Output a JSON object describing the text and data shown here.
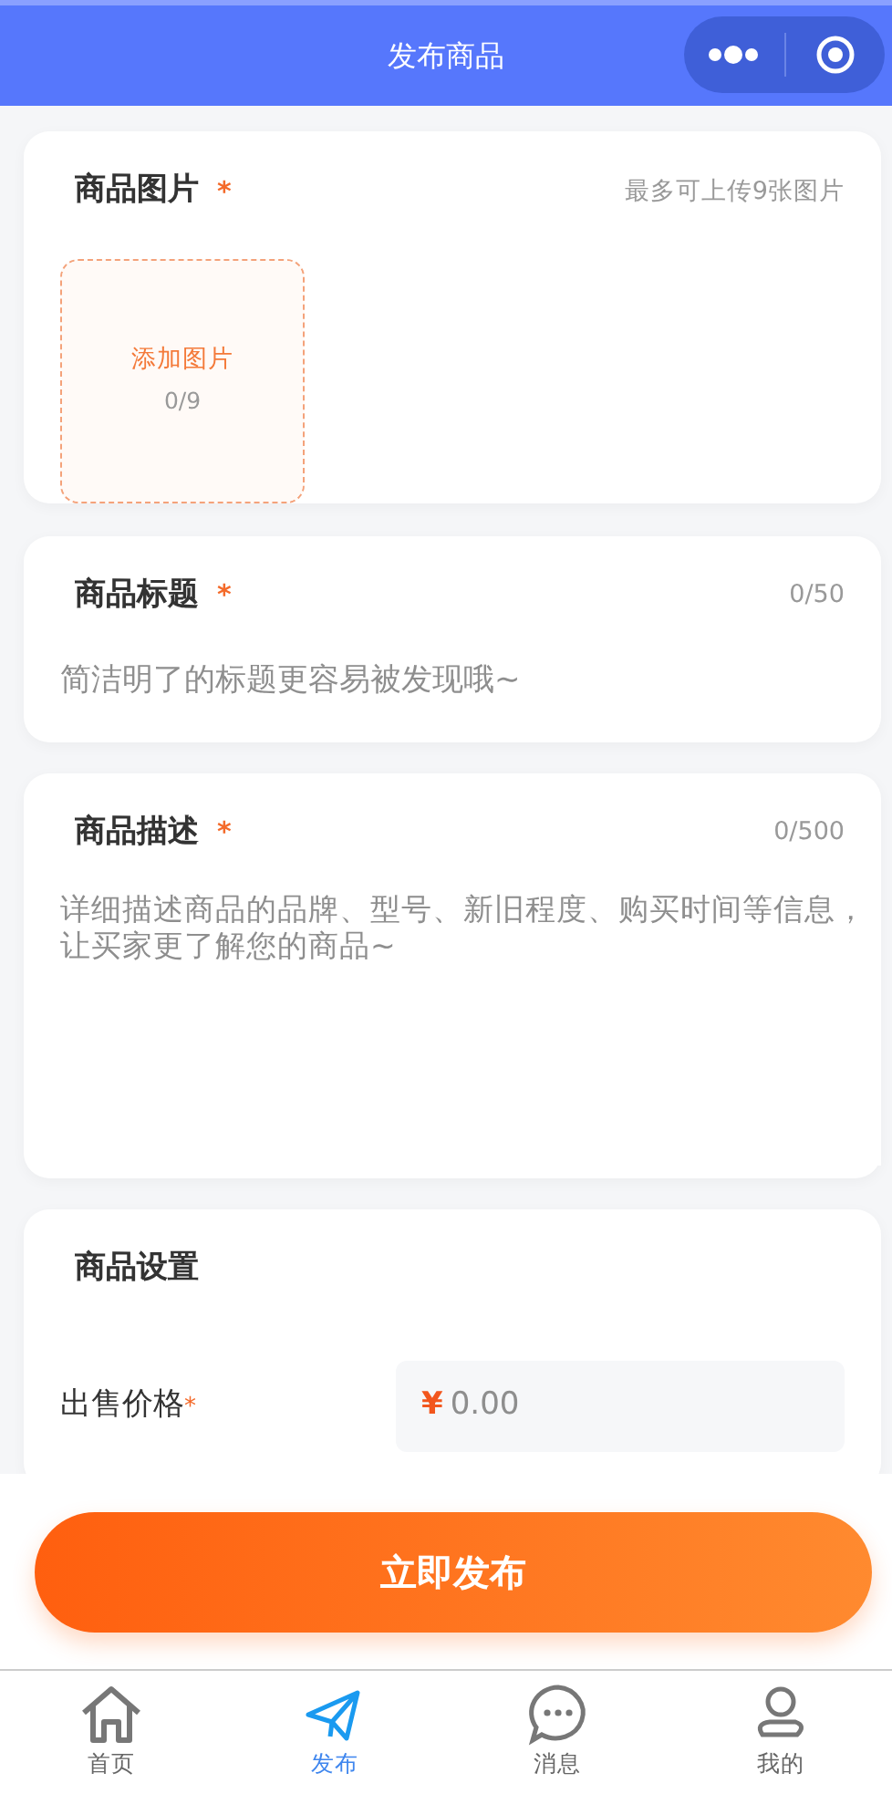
{
  "header": {
    "title": "发布商品"
  },
  "images": {
    "title": "商品图片",
    "required_mark": "*",
    "hint": "最多可上传9张图片",
    "add_label": "添加图片",
    "count": "0/9"
  },
  "title_field": {
    "title": "商品标题",
    "required_mark": "*",
    "counter": "0/50",
    "placeholder": "简洁明了的标题更容易被发现哦~"
  },
  "description_field": {
    "title": "商品描述",
    "required_mark": "*",
    "counter": "0/500",
    "placeholder": "详细描述商品的品牌、型号、新旧程度、购买时间等信息，让买家更了解您的商品~"
  },
  "settings": {
    "title": "商品设置",
    "price_label": "出售价格",
    "required_mark": "*",
    "currency": "¥",
    "price_placeholder": "0.00"
  },
  "submit_button": "立即发布",
  "tabs": [
    {
      "label": "首页",
      "kind": "home",
      "selected": false
    },
    {
      "label": "发布",
      "kind": "publish",
      "selected": true
    },
    {
      "label": "消息",
      "kind": "message",
      "selected": false
    },
    {
      "label": "我的",
      "kind": "profile",
      "selected": false
    }
  ]
}
